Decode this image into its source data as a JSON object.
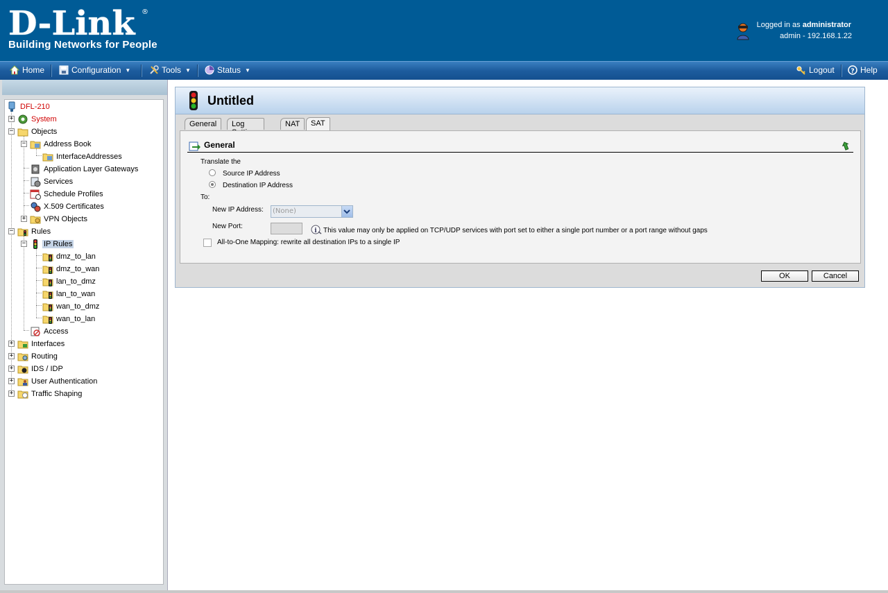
{
  "header": {
    "logo_text": "D-Link",
    "logo_tagline": "Building Networks for People",
    "logged_in_prefix": "Logged in as ",
    "logged_in_user": "administrator",
    "session_info": "admin - 192.168.1.22"
  },
  "menu": {
    "home": "Home",
    "configuration": "Configuration",
    "tools": "Tools",
    "status": "Status",
    "logout": "Logout",
    "help": "Help"
  },
  "tree": {
    "root": "DFL-210",
    "system": "System",
    "objects": "Objects",
    "address_book": "Address Book",
    "interface_addresses": "InterfaceAddresses",
    "alg": "Application Layer Gateways",
    "services": "Services",
    "schedule_profiles": "Schedule Profiles",
    "x509": "X.509 Certificates",
    "vpn_objects": "VPN Objects",
    "rules": "Rules",
    "ip_rules": "IP Rules",
    "rule_items": [
      "dmz_to_lan",
      "dmz_to_wan",
      "lan_to_dmz",
      "lan_to_wan",
      "wan_to_dmz",
      "wan_to_lan"
    ],
    "access": "Access",
    "interfaces": "Interfaces",
    "routing": "Routing",
    "ids_idp": "IDS / IDP",
    "user_auth": "User Authentication",
    "traffic_shaping": "Traffic Shaping"
  },
  "dialog": {
    "title": "Untitled",
    "tabs": [
      "General",
      "Log Settings",
      "NAT",
      "SAT"
    ],
    "active_tab": "SAT",
    "section_title": "General",
    "translate_label": "Translate the",
    "source_ip_label": "Source IP Address",
    "destination_ip_label": "Destination IP Address",
    "selected_translation": "Destination IP Address",
    "to_label": "To:",
    "new_ip_label": "New IP Address:",
    "new_ip_value": "(None)",
    "new_port_label": "New Port:",
    "new_port_value": "",
    "port_info": "This value may only be applied on TCP/UDP services with port set to either a single port number or a port range without gaps",
    "all_to_one_label": "All-to-One Mapping: rewrite all destination IPs to a single IP",
    "all_to_one_checked": false,
    "ok": "OK",
    "cancel": "Cancel"
  },
  "colors": {
    "header_bg": "#005b96",
    "menubar_bg": "#1d5c9e",
    "tree_error_text": "#d00000"
  }
}
